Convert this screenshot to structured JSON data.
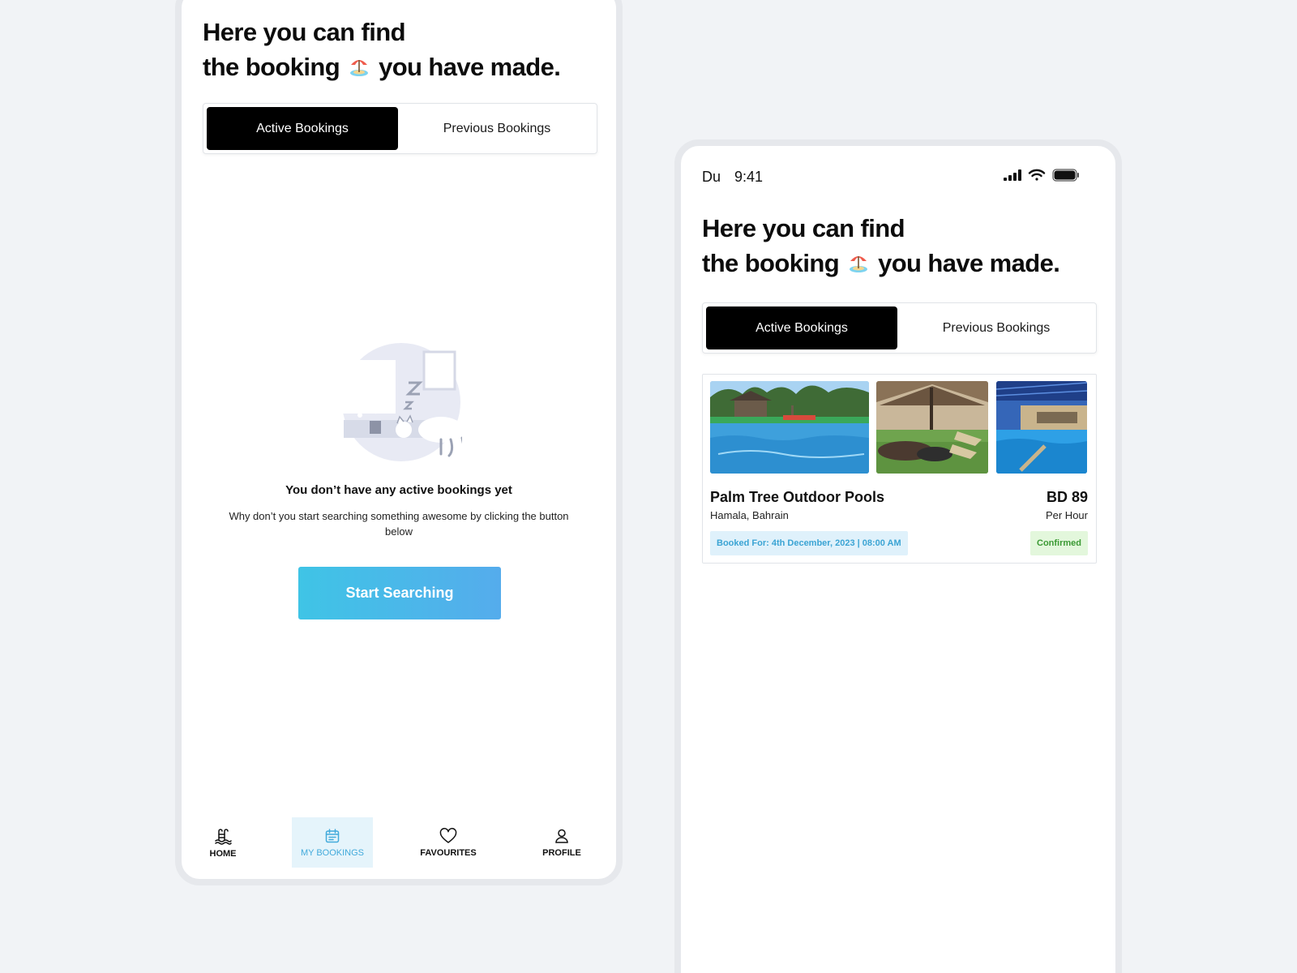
{
  "headline": {
    "line1": "Here you can find",
    "line2_before": "the booking",
    "line2_after": "you have made."
  },
  "tabs": {
    "active": "Active Bookings",
    "previous": "Previous Bookings"
  },
  "empty_state": {
    "title": "You don’t have any active bookings yet",
    "description": "Why don’t you start searching something awesome by clicking the button below",
    "cta": "Start Searching"
  },
  "bottom_nav": [
    {
      "label": "HOME",
      "icon": "pool-ladder-icon",
      "active": false
    },
    {
      "label": "MY BOOKINGS",
      "icon": "calendar-icon",
      "active": true
    },
    {
      "label": "FAVOURITES",
      "icon": "heart-icon",
      "active": false
    },
    {
      "label": "PROFILE",
      "icon": "user-icon",
      "active": false
    }
  ],
  "status_bar": {
    "carrier": "Du",
    "time": "9:41",
    "icons": [
      "signal-icon",
      "wifi-icon",
      "battery-icon"
    ]
  },
  "booking": {
    "name": "Palm Tree Outdoor Pools",
    "location": "Hamala, Bahrain",
    "price": "BD 89",
    "unit": "Per Hour",
    "booked_for": "Booked For: 4th December, 2023 | 08:00 AM",
    "status": "Confirmed"
  },
  "colors": {
    "accent": "#42aadb",
    "cta_start": "#3fc4e6",
    "cta_end": "#55acec",
    "confirmed": "#3b9a34",
    "confirmed_bg": "#e3f7dc",
    "booked_bg": "#dff1fb"
  }
}
